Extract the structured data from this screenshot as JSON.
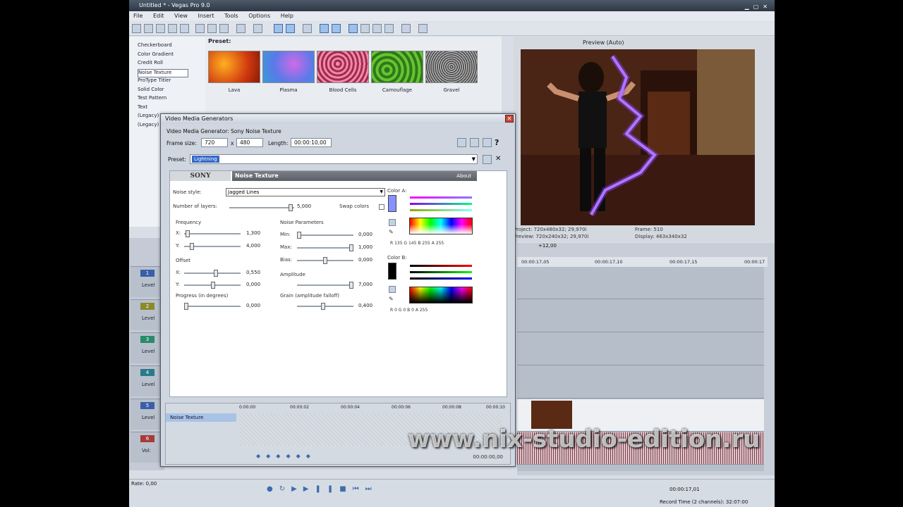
{
  "window": {
    "title": "Untitled * - Vegas Pro 9.0"
  },
  "menu": [
    "File",
    "Edit",
    "View",
    "Insert",
    "Tools",
    "Options",
    "Help"
  ],
  "generators": {
    "items": [
      "Checkerboard",
      "Color Gradient",
      "Credit Roll",
      "Noise Texture",
      "ProType Titler",
      "Solid Color",
      "Test Pattern",
      "Text",
      "(Legacy)",
      "(Legacy)"
    ],
    "selected": "Noise Texture"
  },
  "presets_panel": {
    "label": "Preset:",
    "items": [
      {
        "name": "Lava",
        "color": "#e0561b"
      },
      {
        "name": "Plasma",
        "color": "#6a7de8"
      },
      {
        "name": "Blood Cells",
        "color": "#c23a68"
      },
      {
        "name": "Camouflage",
        "color": "#3f9a2c"
      },
      {
        "name": "Gravel",
        "color": "#9a9a9a"
      }
    ]
  },
  "preview": {
    "mode": "Preview (Auto)",
    "project_label": "Project:",
    "project_value": "720x480x32; 29,970i",
    "preview_label": "Preview:",
    "preview_value": "720x240x32; 29,970i",
    "frame_label": "Frame:",
    "frame_value": "510",
    "display_label": "Display:",
    "display_value": "463x340x32"
  },
  "tracks": [
    {
      "num": "1",
      "label": "Level",
      "color": "#3a5fa8"
    },
    {
      "num": "2",
      "label": "Level",
      "color": "#8a8a2a"
    },
    {
      "num": "3",
      "label": "Level",
      "color": "#2a8a6a"
    },
    {
      "num": "4",
      "label": "Level",
      "color": "#2a7a8a"
    },
    {
      "num": "5",
      "label": "Level",
      "color": "#3a5fa8"
    },
    {
      "num": "6",
      "label": "Vol:",
      "color": "#a83a3a"
    }
  ],
  "timeline": {
    "ruler": [
      "00:00:17,05",
      "00:00:17,10",
      "00:00:17,15",
      "00:00:17"
    ],
    "cursor_time": "+12,00"
  },
  "transport": {
    "rate": "Rate: 0,00",
    "time": "00:00:17,01",
    "record_time": "Record Time (2 channels): 32:07:00"
  },
  "dialog": {
    "title": "Video Media Generators",
    "subtitle": "Video Media Generator: Sony Noise Texture",
    "frame_size_label": "Frame size:",
    "frame_w": "720",
    "x_label": "x",
    "frame_h": "480",
    "length_label": "Length:",
    "length_value": "00:00:10,00",
    "preset_label": "Preset:",
    "preset_value": "Lightning",
    "close": "✕",
    "plugin": {
      "brand": "SONY",
      "name": "Noise Texture",
      "about": "About",
      "noise_style_label": "Noise style:",
      "noise_style_value": "Jagged Lines",
      "layers_label": "Number of layers:",
      "layers_value": "5,000",
      "swap_label": "Swap colors",
      "frequency_label": "Frequency",
      "freq_x_label": "X:",
      "freq_x": "1,300",
      "freq_y_label": "Y:",
      "freq_y": "4,000",
      "offset_label": "Offset",
      "off_x_label": "X:",
      "off_x": "0,550",
      "off_y_label": "Y:",
      "off_y": "0,000",
      "progress_label": "Progress (in degrees)",
      "progress": "0,000",
      "noise_params_label": "Noise Parameters",
      "min_label": "Min:",
      "min": "0,000",
      "max_label": "Max:",
      "max": "1,000",
      "bias_label": "Bias:",
      "bias": "0,000",
      "amplitude_label": "Amplitude",
      "amplitude": "7,000",
      "grain_label": "Grain (amplitude falloff)",
      "grain": "0,400",
      "color_a_label": "Color A:",
      "color_a_rgba": "R 135  G 145  B 255  A 255",
      "color_b_label": "Color B:",
      "color_b_rgba": "R 0  G 0  B 0  A 255"
    },
    "keyframes": {
      "track": "Noise Texture",
      "ruler": [
        "0:00:00",
        "00:00:02",
        "00:00:04",
        "00:00:06",
        "00:00:08",
        "00:00:10"
      ],
      "time": "00:00:00,00"
    }
  },
  "watermark": "www.nix-studio-edition.ru"
}
